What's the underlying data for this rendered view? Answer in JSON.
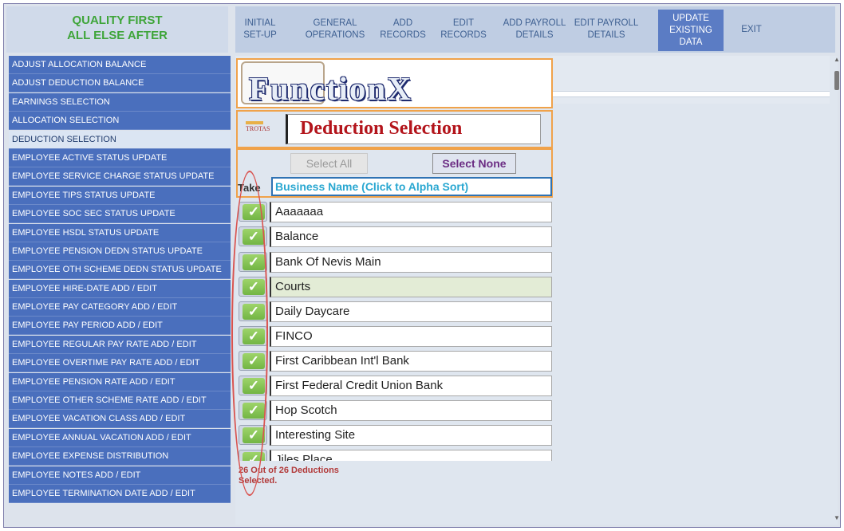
{
  "brand": {
    "line1": "QUALITY FIRST",
    "line2": "ALL ELSE AFTER"
  },
  "topnav": [
    {
      "label": "INITIAL\nSET-UP"
    },
    {
      "label": "GENERAL\nOPERATIONS"
    },
    {
      "label": "ADD\nRECORDS"
    },
    {
      "label": "EDIT\nRECORDS"
    },
    {
      "label": "ADD PAYROLL\nDETAILS"
    },
    {
      "label": "EDIT PAYROLL\nDETAILS"
    },
    {
      "label": "UPDATE\nEXISTING\nDATA"
    },
    {
      "label": "EXIT"
    }
  ],
  "sidebar": {
    "items": [
      {
        "label": "ADJUST ALLOCATION BALANCE"
      },
      {
        "label": "ADJUST DEDUCTION BALANCE"
      },
      {
        "label": "EARNINGS SELECTION"
      },
      {
        "label": "ALLOCATION SELECTION"
      },
      {
        "label": "DEDUCTION SELECTION"
      },
      {
        "label": "EMPLOYEE ACTIVE STATUS UPDATE"
      },
      {
        "label": "EMPLOYEE SERVICE CHARGE STATUS UPDATE"
      },
      {
        "label": "EMPLOYEE TIPS STATUS UPDATE"
      },
      {
        "label": "EMPLOYEE SOC SEC STATUS UPDATE"
      },
      {
        "label": "EMPLOYEE HSDL STATUS UPDATE"
      },
      {
        "label": "EMPLOYEE PENSION DEDN STATUS UPDATE"
      },
      {
        "label": "EMPLOYEE OTH SCHEME DEDN STATUS UPDATE"
      },
      {
        "label": "EMPLOYEE HIRE-DATE ADD / EDIT"
      },
      {
        "label": "EMPLOYEE PAY CATEGORY ADD / EDIT"
      },
      {
        "label": "EMPLOYEE PAY PERIOD ADD / EDIT"
      },
      {
        "label": "EMPLOYEE REGULAR PAY RATE ADD / EDIT"
      },
      {
        "label": "EMPLOYEE OVERTIME PAY RATE ADD / EDIT"
      },
      {
        "label": "EMPLOYEE PENSION RATE ADD / EDIT"
      },
      {
        "label": "EMPLOYEE OTHER SCHEME RATE ADD / EDIT"
      },
      {
        "label": "EMPLOYEE VACATION CLASS ADD / EDIT"
      },
      {
        "label": "EMPLOYEE ANNUAL VACATION ADD / EDIT"
      },
      {
        "label": "EMPLOYEE EXPENSE DISTRIBUTION"
      },
      {
        "label": "EMPLOYEE NOTES ADD / EDIT"
      },
      {
        "label": "EMPLOYEE TERMINATION DATE ADD / EDIT"
      }
    ]
  },
  "logo": {
    "text": "FunctionX",
    "small": "TROTAS"
  },
  "form": {
    "title": "Deduction Selection"
  },
  "buttons": {
    "select_all": "Select All",
    "select_none": "Select None"
  },
  "table": {
    "col_take": "Take",
    "col_name": "Business Name (Click to Alpha Sort)",
    "rows": [
      {
        "name": "Aaaaaaa",
        "checked": "✓"
      },
      {
        "name": "Balance",
        "checked": "✓"
      },
      {
        "name": "Bank Of Nevis Main",
        "checked": "✓"
      },
      {
        "name": "Courts",
        "checked": "✓"
      },
      {
        "name": "Daily Daycare",
        "checked": "✓"
      },
      {
        "name": "FINCO",
        "checked": "✓"
      },
      {
        "name": "First Caribbean Int'l Bank",
        "checked": "✓"
      },
      {
        "name": "First Federal Credit Union Bank",
        "checked": "✓"
      },
      {
        "name": "Hop Scotch",
        "checked": "✓"
      },
      {
        "name": "Interesting Site",
        "checked": "✓"
      },
      {
        "name": "Jiles Place.....",
        "checked": "✓"
      }
    ]
  },
  "status": {
    "text": "26 Out of 26 Deductions Selected."
  },
  "colors": {
    "accent": "#4a6fbd",
    "highlight_border": "#f0a24a",
    "check_green": "#72b544",
    "title_red": "#b3141b"
  }
}
